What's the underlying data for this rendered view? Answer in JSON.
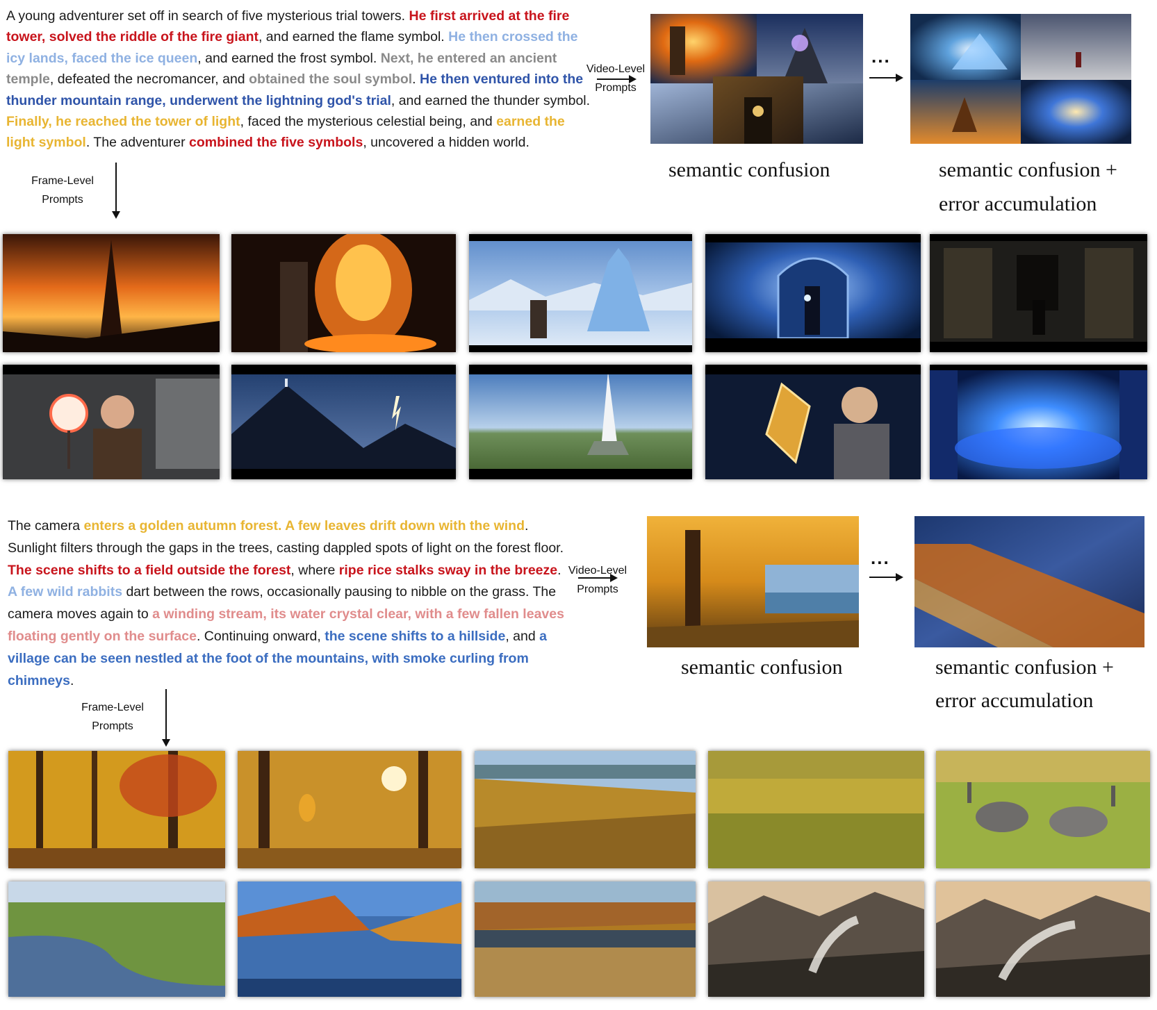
{
  "top": {
    "story": [
      {
        "text": "A young adventurer set off in search of five mysterious trial towers. ",
        "color": ""
      },
      {
        "text": "He first arrived at the fire tower, solved the riddle of the fire giant",
        "color": "red"
      },
      {
        "text": ", and earned the flame symbol. ",
        "color": ""
      },
      {
        "text": "He then crossed the icy lands, faced the ice queen",
        "color": "lblue"
      },
      {
        "text": ", and earned the frost symbol. ",
        "color": ""
      },
      {
        "text": "Next, he entered an ancient temple",
        "color": "gray"
      },
      {
        "text": ", defeated the necromancer, and ",
        "color": ""
      },
      {
        "text": "obtained the soul symbol",
        "color": "gray"
      },
      {
        "text": ". ",
        "color": ""
      },
      {
        "text": "He then ventured into the thunder mountain range, underwent the lightning god's trial",
        "color": "blue"
      },
      {
        "text": ", and earned the thunder symbol. ",
        "color": ""
      },
      {
        "text": "Finally, he reached the tower of light",
        "color": "gold"
      },
      {
        "text": ", faced the mysterious celestial being, and ",
        "color": ""
      },
      {
        "text": "earned the light symbol",
        "color": "gold"
      },
      {
        "text": ". The adventurer ",
        "color": ""
      },
      {
        "text": "combined the five symbols",
        "color": "red"
      },
      {
        "text": ", uncovered a hidden world.",
        "color": ""
      }
    ],
    "video_level_label": "Video-Level\nPrompts",
    "frame_level_label": "Frame-Level\nPrompts",
    "ellipsis": "...",
    "caption_left": "semantic confusion",
    "caption_right_1": "semantic confusion +",
    "caption_right_2": "error accumulation",
    "frame_scenes": [
      "fire tower at sunset",
      "fire giant and adventurer",
      "ice palace in snow field",
      "ice queen in blue hall",
      "dark ancient temple corridor",
      "boy holding glowing symbol",
      "lone figure on thunder mountain",
      "tower of light over plain",
      "boy with golden lightning symbol",
      "glowing blue portal chamber"
    ]
  },
  "bottom": {
    "story": [
      {
        "text": "The camera ",
        "color": ""
      },
      {
        "text": "enters a golden autumn forest. A few leaves drift down with the wind",
        "color": "gold"
      },
      {
        "text": ". Sunlight filters through the gaps in the trees, casting dappled spots of light on the forest floor. ",
        "color": ""
      },
      {
        "text": "The scene shifts to a field outside the forest",
        "color": "red"
      },
      {
        "text": ", where ",
        "color": ""
      },
      {
        "text": "ripe rice stalks sway in the breeze",
        "color": "red"
      },
      {
        "text": ". ",
        "color": ""
      },
      {
        "text": "A few wild rabbits",
        "color": "lblue"
      },
      {
        "text": " dart between the rows, occasionally pausing to nibble on the grass. The camera moves again to ",
        "color": ""
      },
      {
        "text": "a winding stream, its water crystal clear, with a few fallen leaves floating gently on the surface",
        "color": "pink"
      },
      {
        "text": ". Continuing onward, ",
        "color": ""
      },
      {
        "text": "the scene shifts to a hillside",
        "color": "mblue"
      },
      {
        "text": ", and ",
        "color": ""
      },
      {
        "text": "a village can be seen nestled at the foot of the mountains, with smoke curling from chimneys",
        "color": "mblue"
      },
      {
        "text": ".",
        "color": ""
      }
    ],
    "video_level_label": "Video-Level\nPrompts",
    "frame_level_label": "Frame-Level\nPrompts",
    "ellipsis": "...",
    "caption_left": "semantic confusion",
    "caption_right_1": "semantic confusion +",
    "caption_right_2": "error accumulation",
    "frame_scenes": [
      "golden autumn forest",
      "leaves drifting in forest",
      "autumn forest landscape",
      "ripe rice field",
      "rabbits in grass",
      "winding stream in meadow",
      "stream through autumn trees",
      "leaves floating on stream",
      "village at foot of mountains with smoke",
      "village with chimney smoke at sunset"
    ]
  },
  "colors": {
    "red": "#c8141c",
    "lblue": "#8fb1e2",
    "gray": "#8a8a8a",
    "blue": "#2f54a9",
    "gold": "#e8b532",
    "pink": "#e08c8c",
    "mblue": "#3b6dc0"
  }
}
